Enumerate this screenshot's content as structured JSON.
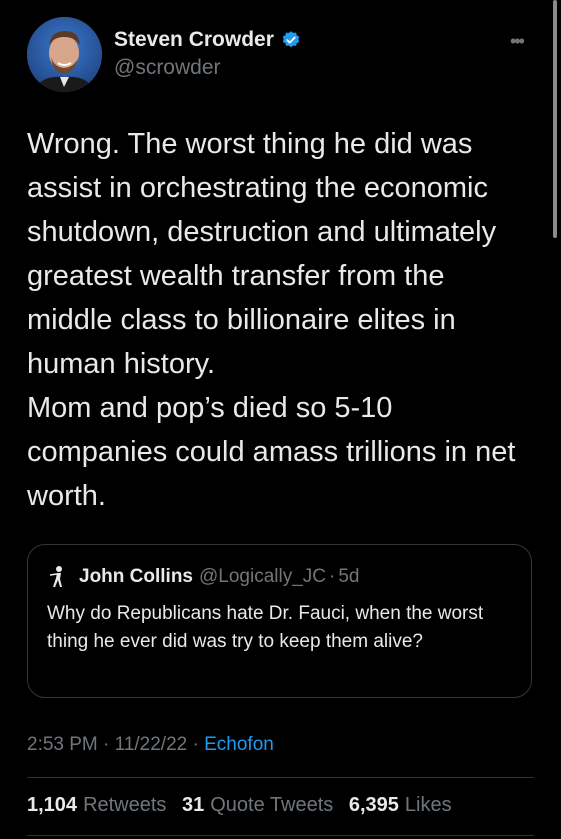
{
  "tweet": {
    "author_name": "Steven Crowder",
    "author_handle": "@scrowder",
    "more_icon": "more-horizontal-icon",
    "text": "Wrong. The worst thing he did was\nassist in orchestrating the economic\nshutdown, destruction and ultimately\ngreatest wealth transfer from the\nmiddle class to billionaire elites in\nhuman history.\nMom and pop’s died so 5-10\ncompanies could amass trillions in net\nworth.",
    "quote": {
      "author_name": "John Collins",
      "author_handle": "@Logically_JC",
      "separator": "·",
      "time": "5d",
      "text": "Why do Republicans hate Dr. Fauci, when the worst thing he ever did was try to keep them alive?"
    },
    "time": "2:53 PM",
    "separator": "·",
    "date": "11/22/22",
    "source": "Echofon",
    "stats": {
      "retweets": "1,104",
      "retweets_label": "Retweets",
      "quote_tweets": "31",
      "quote_tweets_label": "Quote Tweets",
      "likes": "6,395",
      "likes_label": "Likes"
    }
  },
  "colors": {
    "background": "#000000",
    "text": "#e7e9ea",
    "secondary": "#71767b",
    "accent": "#1d9bf0"
  }
}
